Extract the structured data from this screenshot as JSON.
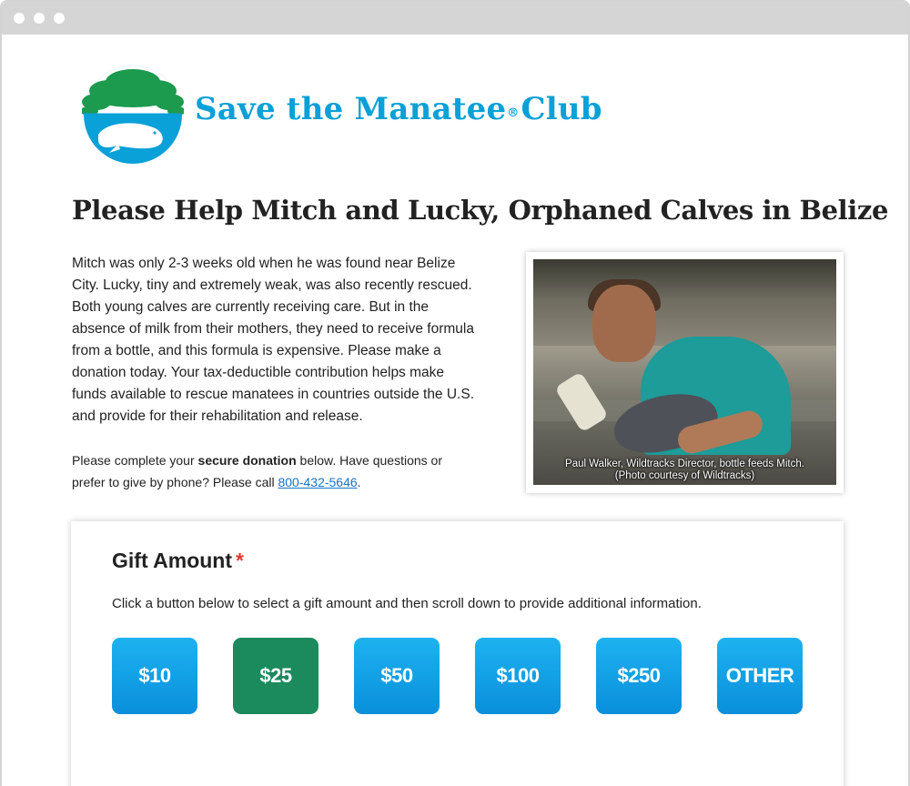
{
  "brand": {
    "name_prefix": "Save the Manatee",
    "registered_mark": "®",
    "name_suffix": "Club",
    "colors": {
      "blue": "#0aa0d8",
      "green": "#1c9a4e"
    }
  },
  "headline": "Please Help Mitch and Lucky, Orphaned Calves in Belize",
  "story": "Mitch was only 2-3 weeks old when he was found near Belize City. Lucky, tiny and extremely weak, was also recently rescued. Both young calves are currently receiving care. But in the absence of milk from their mothers, they need to receive formula from a bottle, and this formula is expensive. Please make a donation today. Your tax-deductible contribution helps make funds available to rescue manatees in countries outside the U.S. and provide for their rehabilitation and release.",
  "secure_note": {
    "before": "Please complete your ",
    "bold": "secure donation",
    "middle": " below. Have questions or prefer to give by phone? Please call ",
    "phone": "800-432-5646",
    "after": "."
  },
  "photo": {
    "caption_line1": "Paul Walker, Wildtracks Director, bottle feeds Mitch.",
    "caption_line2": "(Photo courtesy of Wildtracks)"
  },
  "gift": {
    "title": "Gift Amount",
    "required_marker": "*",
    "instructions": "Click a button below to select a gift amount and then scroll down to provide additional information.",
    "amounts": [
      "$10",
      "$25",
      "$50",
      "$100",
      "$250",
      "OTHER"
    ],
    "selected": "$25",
    "colors": {
      "button": "#0a9ae0",
      "selected": "#1b8a5c",
      "required": "#e03a2e"
    }
  }
}
